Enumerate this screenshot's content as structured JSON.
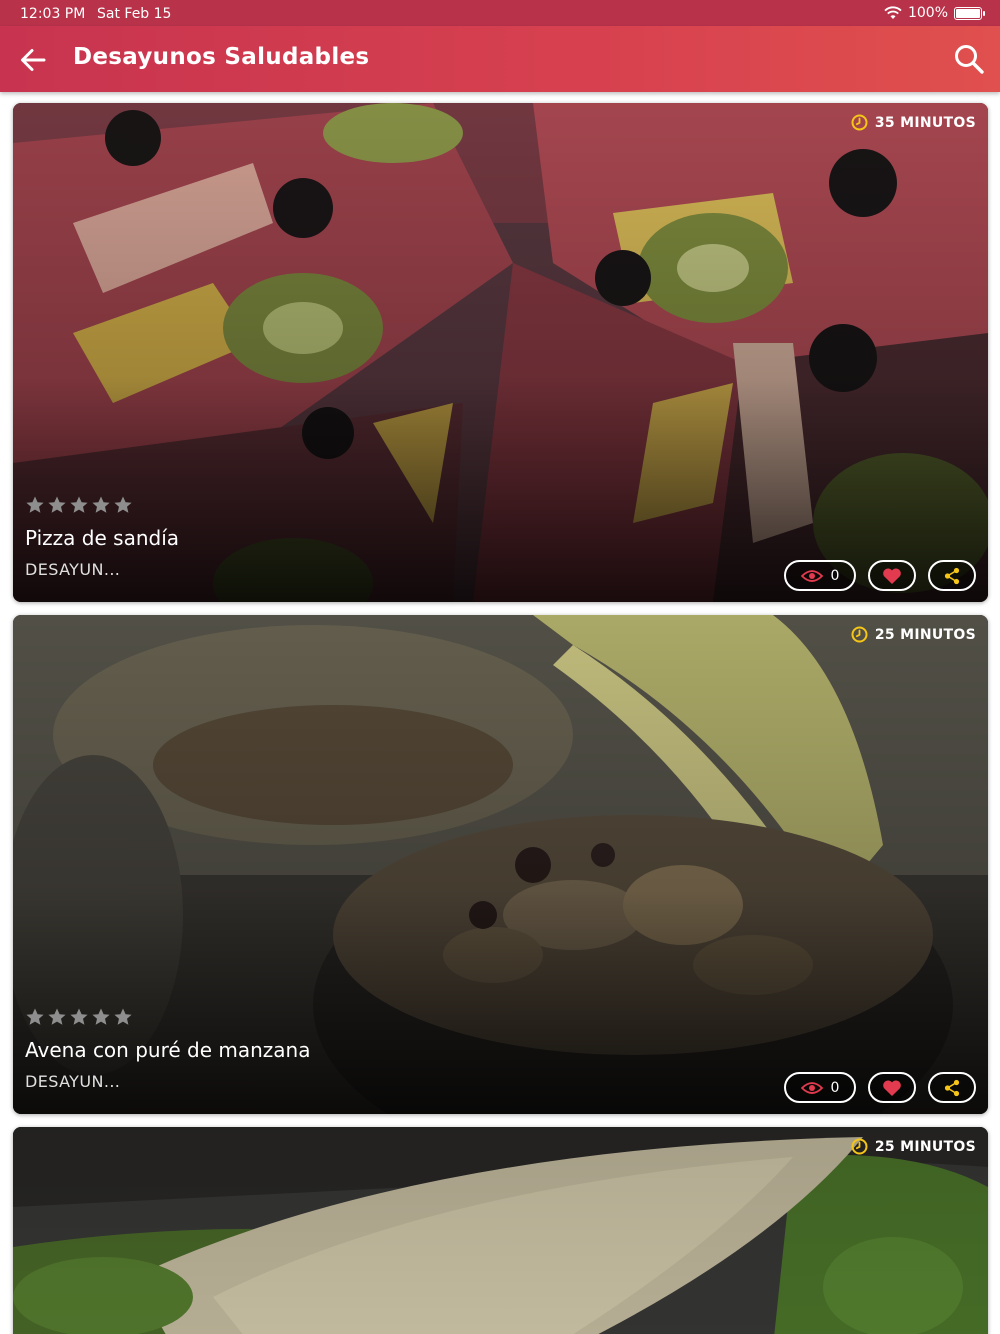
{
  "status_bar": {
    "time": "12:03 PM",
    "date": "Sat Feb 15",
    "battery": "100%"
  },
  "app_bar": {
    "title": "Desayunos Saludables"
  },
  "colors": {
    "brand": "#c8344f",
    "accent": "#e0504e",
    "clock": "#f5c518",
    "heart": "#e23a4e"
  },
  "recipes": [
    {
      "time": "35 MINUTOS",
      "rating": 5,
      "title": "Pizza de sandía",
      "category": "DESAYUN...",
      "views": "0"
    },
    {
      "time": "25 MINUTOS",
      "rating": 5,
      "title": "Avena con puré de manzana",
      "category": "DESAYUN...",
      "views": "0"
    },
    {
      "time": "25 MINUTOS"
    }
  ]
}
